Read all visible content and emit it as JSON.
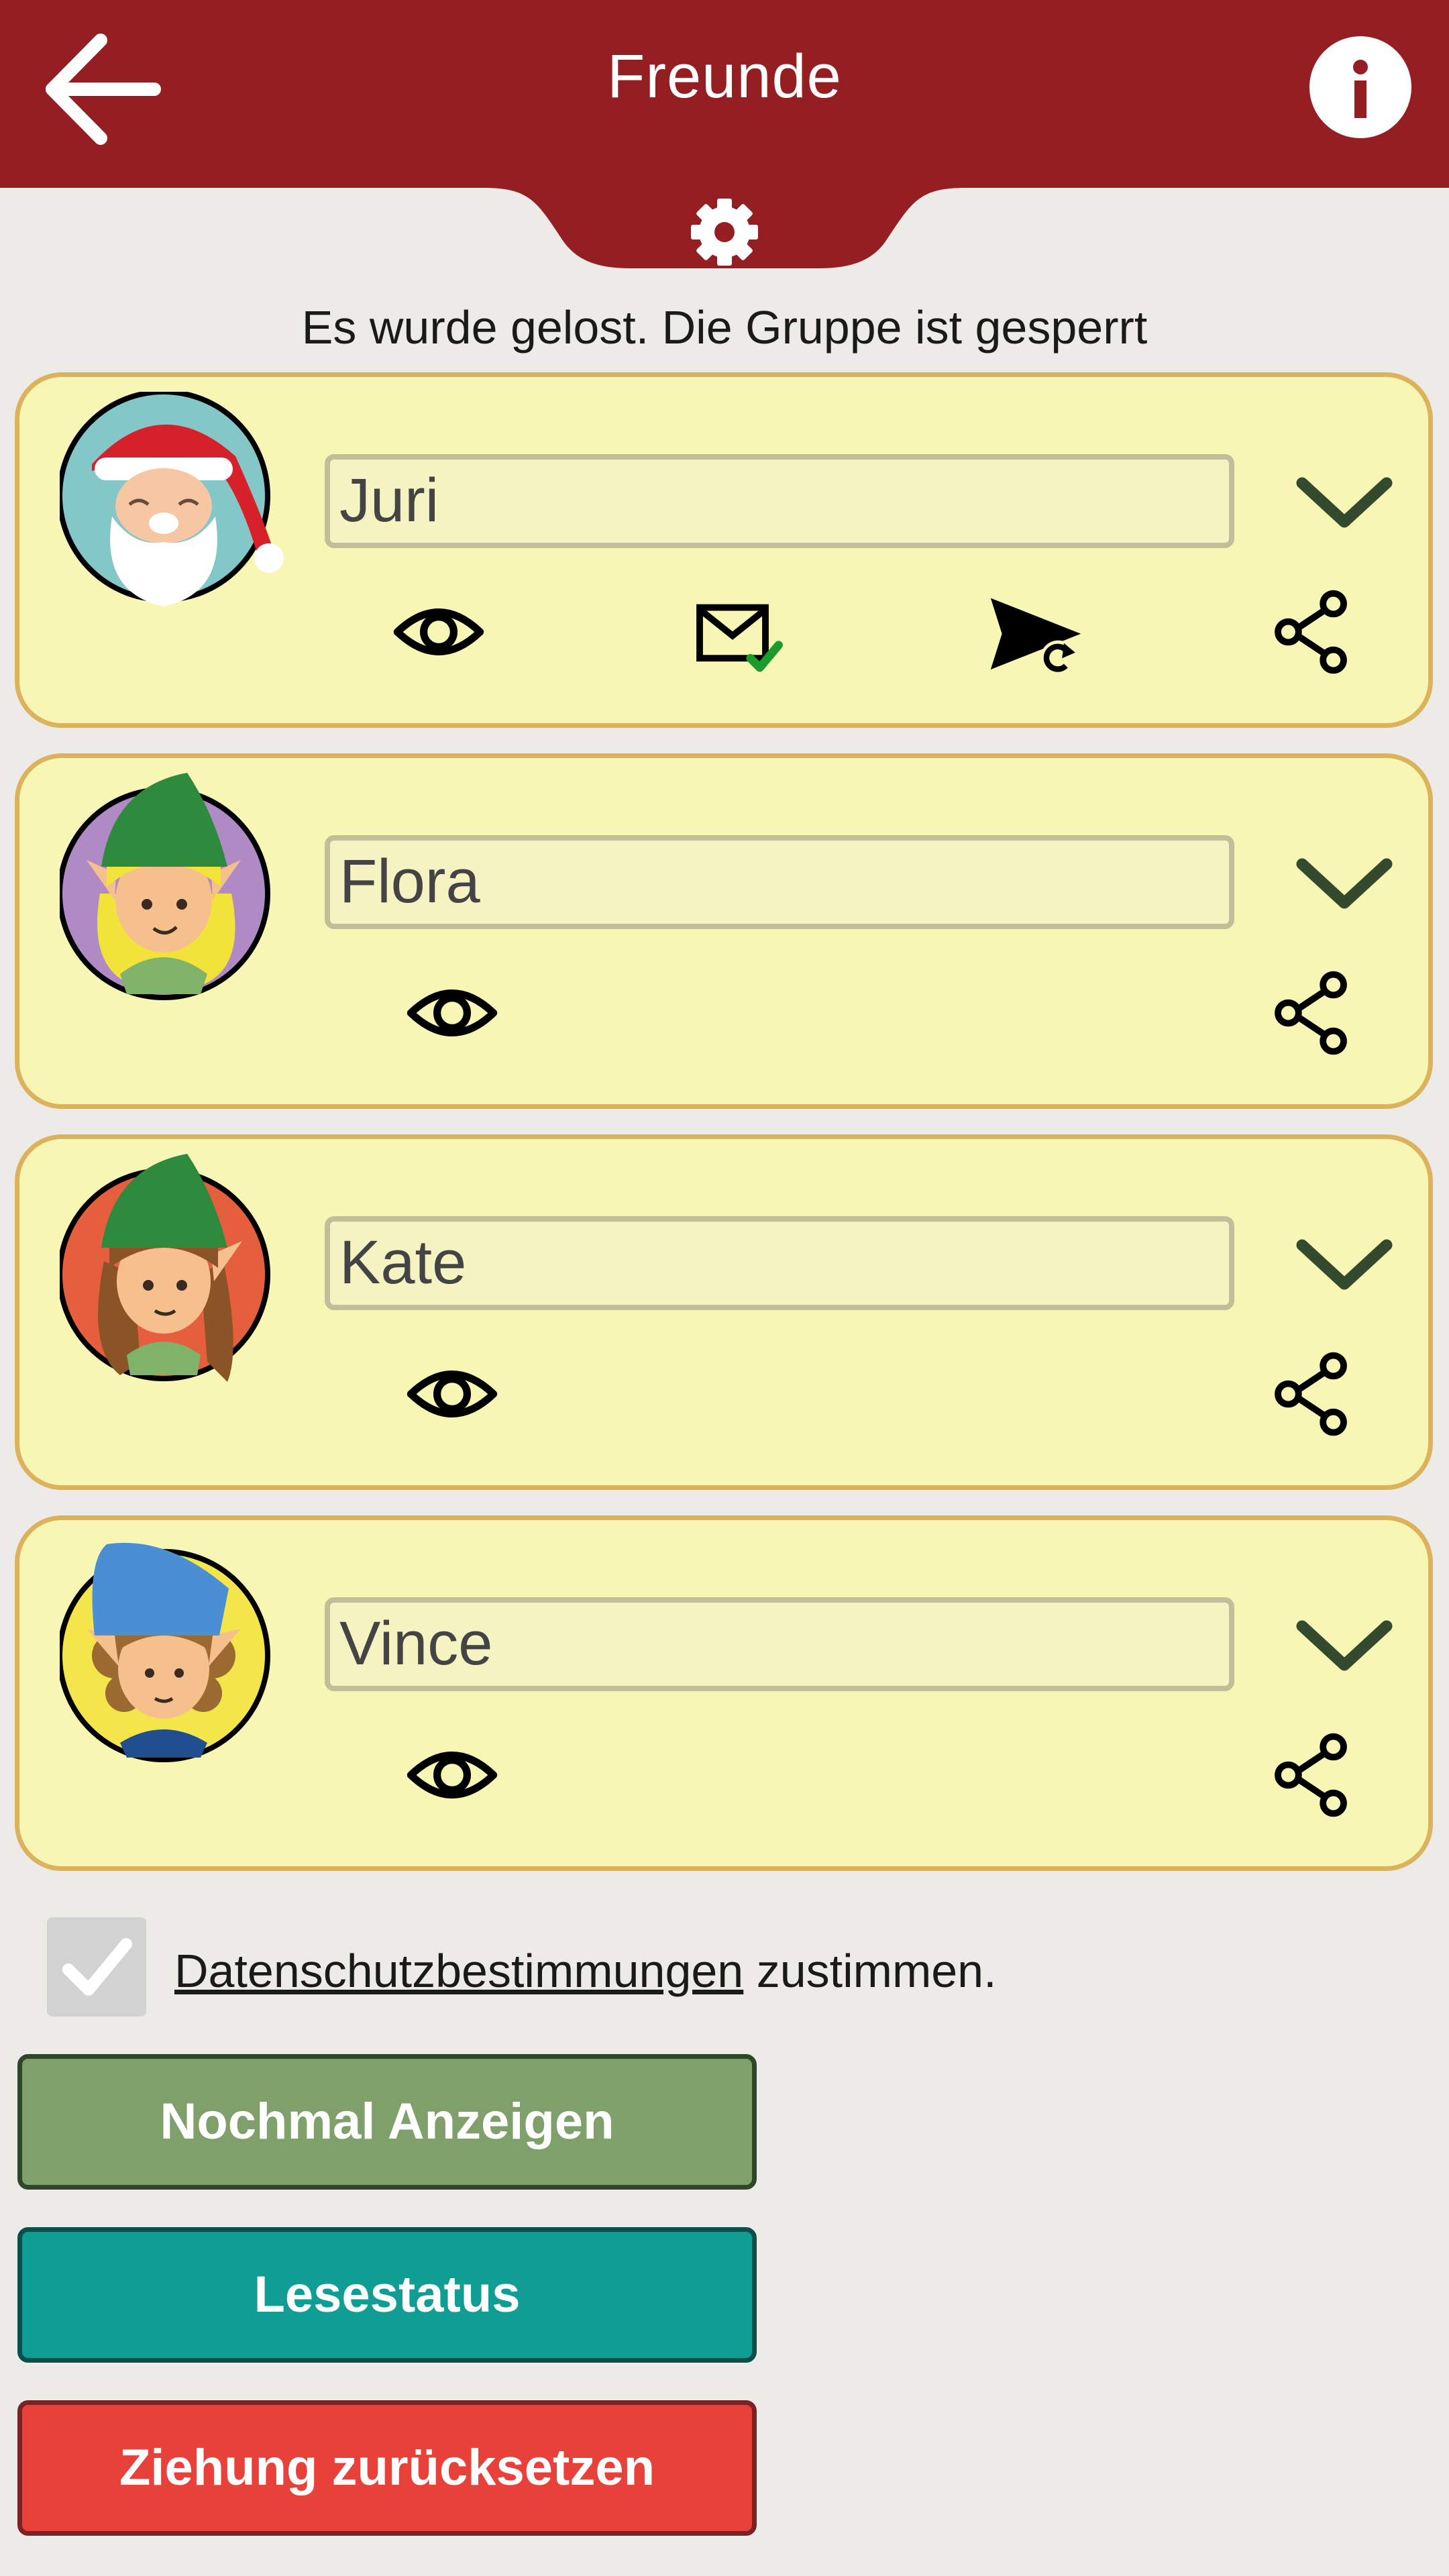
{
  "header": {
    "title": "Freunde",
    "back_icon": "arrow-left-icon",
    "info_icon": "info-icon",
    "settings_icon": "gear-icon",
    "background_color": "#951e23"
  },
  "status_text": "Es wurde gelost. Die Gruppe ist gesperrt",
  "friends": [
    {
      "name": "Juri",
      "avatar": "santa-avatar",
      "actions": [
        "eye-icon",
        "mail-read-icon",
        "resend-icon",
        "share-icon"
      ]
    },
    {
      "name": "Flora",
      "avatar": "elf-girl-blonde-avatar",
      "actions": [
        "eye-icon",
        "share-icon"
      ]
    },
    {
      "name": "Kate",
      "avatar": "elf-girl-brown-avatar",
      "actions": [
        "eye-icon",
        "share-icon"
      ]
    },
    {
      "name": "Vince",
      "avatar": "elf-boy-curly-avatar",
      "actions": [
        "eye-icon",
        "share-icon"
      ]
    }
  ],
  "privacy": {
    "checked": true,
    "link_text": "Datenschutzbestimmungen",
    "suffix_text": " zustimmen."
  },
  "buttons": {
    "show_again": "Nochmal Anzeigen",
    "read_status": "Lesestatus",
    "reset_draw": "Ziehung zurücksetzen"
  },
  "colors": {
    "card_background": "#f7f6b4",
    "card_border": "#dcb35c",
    "button_green": "#7f9f6b",
    "button_teal": "#109d93",
    "button_red": "#e8413a"
  }
}
